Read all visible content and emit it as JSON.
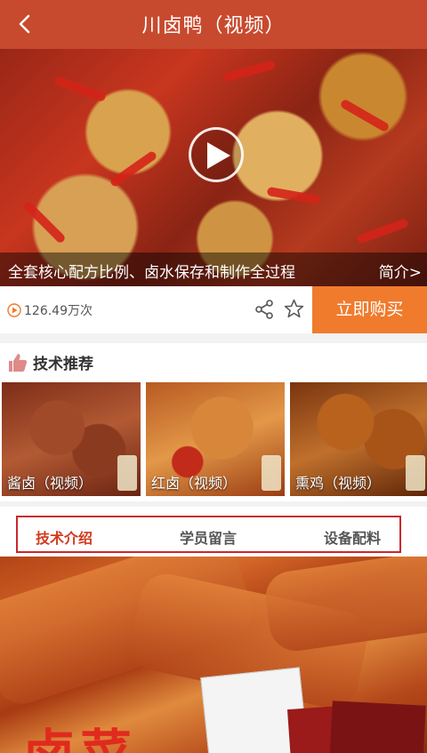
{
  "header": {
    "title": "川卤鸭（视频）"
  },
  "video": {
    "caption": "全套核心配方比例、卤水保存和制作全过程",
    "intro_label": "简介>"
  },
  "stats": {
    "play_count": "126.49万次"
  },
  "actions": {
    "buy_label": "立即购买"
  },
  "recommendation": {
    "title": "技术推荐",
    "items": [
      {
        "label": "酱卤（视频）"
      },
      {
        "label": "红卤（视频）"
      },
      {
        "label": "熏鸡（视频）"
      }
    ]
  },
  "tabs": [
    {
      "label": "技术介绍",
      "active": true
    },
    {
      "label": "学员留言",
      "active": false
    },
    {
      "label": "设备配料",
      "active": false
    }
  ],
  "product": {
    "banner_text": "卤菜"
  },
  "colors": {
    "header": "#c84a2e",
    "buy_button": "#f07b2d",
    "active_tab": "#d23a1e",
    "tab_border": "#c9282b"
  }
}
